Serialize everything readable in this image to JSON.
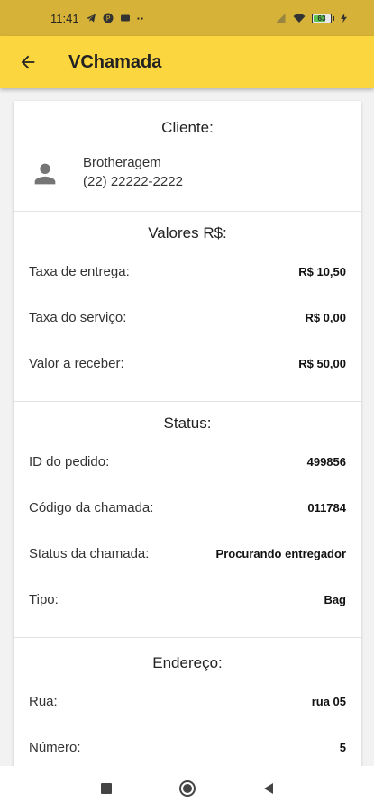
{
  "status_bar": {
    "time": "11:41",
    "dots": "··",
    "battery": "63"
  },
  "app_bar": {
    "title": "VChamada"
  },
  "client": {
    "heading": "Cliente:",
    "name": "Brotheragem",
    "phone": "(22) 22222-2222"
  },
  "values": {
    "heading": "Valores R$:",
    "rows": [
      {
        "label": "Taxa de entrega:",
        "value": "R$ 10,50"
      },
      {
        "label": "Taxa do serviço:",
        "value": "R$ 0,00"
      },
      {
        "label": "Valor a receber:",
        "value": "R$ 50,00"
      }
    ]
  },
  "status": {
    "heading": "Status:",
    "rows": [
      {
        "label": "ID do pedido:",
        "value": "499856"
      },
      {
        "label": "Código da chamada:",
        "value": "011784"
      },
      {
        "label": "Status da chamada:",
        "value": "Procurando entregador"
      },
      {
        "label": "Tipo:",
        "value": "Bag"
      }
    ]
  },
  "address": {
    "heading": "Endereço:",
    "rows": [
      {
        "label": "Rua:",
        "value": "rua 05"
      },
      {
        "label": "Número:",
        "value": "5"
      }
    ]
  },
  "colors": {
    "app_bar": "#fcd63f",
    "status_bar": "#d6b238",
    "background": "#f2f2f2"
  }
}
